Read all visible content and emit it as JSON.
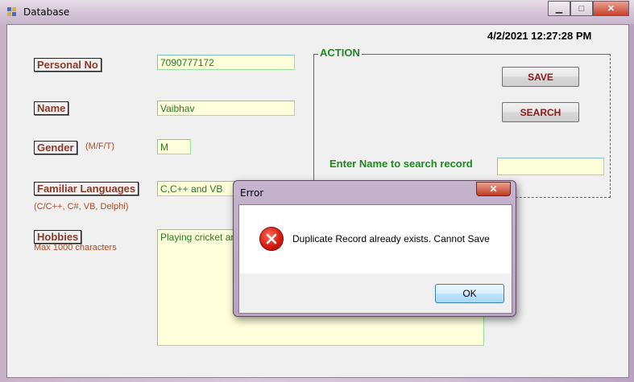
{
  "window": {
    "title": "Database",
    "minimize_glyph": "▁",
    "maximize_glyph": "□",
    "close_glyph": "✕"
  },
  "datetime": "4/2/2021 12:27:28 PM",
  "form": {
    "personal_no": {
      "label": "Personal No",
      "value": "7090777172"
    },
    "name": {
      "label": "Name",
      "value": "Vaibhav"
    },
    "gender": {
      "label": "Gender",
      "hint": "(M/F/T)",
      "value": "M"
    },
    "languages": {
      "label": "Familiar Languages",
      "hint": "(C/C++, C#, VB, Delphi)",
      "value": "C,C++ and VB"
    },
    "hobbies": {
      "label": "Hobbies",
      "hint": "Max 1000 characters",
      "value": "Playing cricket and"
    }
  },
  "action": {
    "title": "ACTION",
    "save_label": "SAVE",
    "search_label": "SEARCH",
    "search_prompt": "Enter Name to search record",
    "search_value": ""
  },
  "dialog": {
    "title": "Error",
    "close_glyph": "✕",
    "icon": "error-icon",
    "message": "Duplicate Record already exists. Cannot Save",
    "ok_label": "OK"
  },
  "colors": {
    "label_text": "#8b3a2a",
    "field_bg": "#ffffdc",
    "field_text": "#237a23",
    "action_green": "#1c8a1c",
    "button_text": "#8b1a1a"
  }
}
